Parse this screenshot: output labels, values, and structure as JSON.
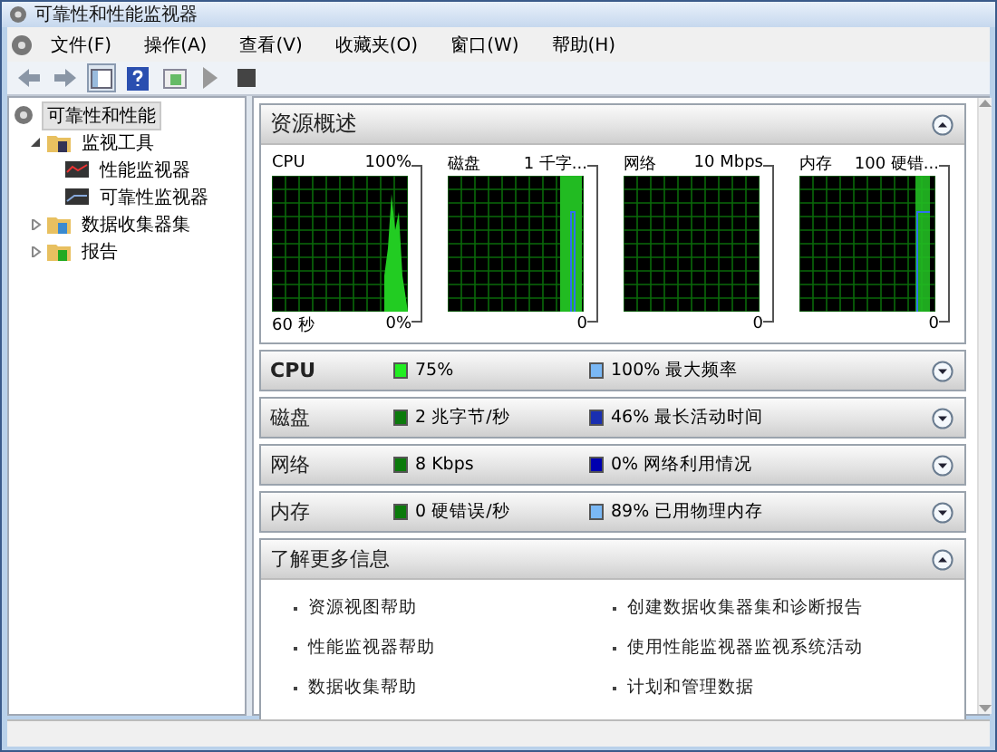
{
  "window": {
    "title": "可靠性和性能监视器"
  },
  "menu": [
    "文件(F)",
    "操作(A)",
    "查看(V)",
    "收藏夹(O)",
    "窗口(W)",
    "帮助(H)"
  ],
  "tree": [
    {
      "label": "可靠性和性能",
      "selected": true,
      "children": [
        {
          "label": "监视工具",
          "selected": false,
          "expanded": true,
          "children": [
            {
              "label": "性能监视器",
              "selected": false
            },
            {
              "label": "可靠性监视器",
              "selected": false
            }
          ]
        },
        {
          "label": "数据收集器集",
          "selected": false,
          "expanded": false
        },
        {
          "label": "报告",
          "selected": false,
          "expanded": false
        }
      ]
    }
  ],
  "overview": {
    "title": "资源概述",
    "expanded": true,
    "graphs": [
      {
        "name": "CPU",
        "max": "100%",
        "min": "0%",
        "time": "60 秒"
      },
      {
        "name": "磁盘",
        "max": "1 千字...",
        "min": "0"
      },
      {
        "name": "网络",
        "max": "10 Mbps",
        "min": "0"
      },
      {
        "name": "内存",
        "max": "100 硬错...",
        "min": "0"
      }
    ]
  },
  "sections": [
    {
      "title": "CPU",
      "bold": true,
      "expanded": false,
      "stats": [
        {
          "text": "75%",
          "color": "#22ee22"
        },
        {
          "text": "100% 最大频率",
          "color": "#7ab8f5"
        }
      ]
    },
    {
      "title": "磁盘",
      "bold": false,
      "expanded": false,
      "stats": [
        {
          "text": "2 兆字节/秒",
          "color": "#0b7a0b"
        },
        {
          "text": "46% 最长活动时间",
          "color": "#1a2fb0"
        }
      ]
    },
    {
      "title": "网络",
      "bold": false,
      "expanded": false,
      "stats": [
        {
          "text": "8 Kbps",
          "color": "#0b7a0b"
        },
        {
          "text": "0% 网络利用情况",
          "color": "#0000b0"
        }
      ]
    },
    {
      "title": "内存",
      "bold": false,
      "expanded": false,
      "stats": [
        {
          "text": "0 硬错误/秒",
          "color": "#0b7a0b"
        },
        {
          "text": "89% 已用物理内存",
          "color": "#7ab8f5"
        }
      ]
    }
  ],
  "learn_more": {
    "title": "了解更多信息",
    "expanded": true,
    "links": [
      "资源视图帮助",
      "创建数据收集器集和诊断报告",
      "性能监视器帮助",
      "使用性能监视器监视系统活动",
      "数据收集帮助",
      "计划和管理数据"
    ]
  }
}
